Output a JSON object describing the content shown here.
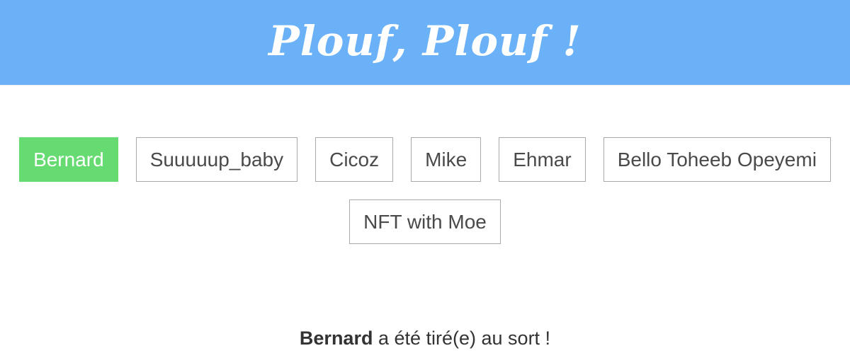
{
  "header": {
    "title": "Plouf, Plouf !",
    "background_color": "#6ab1f7"
  },
  "names": [
    {
      "label": "Bernard",
      "selected": true
    },
    {
      "label": "Suuuuup_baby",
      "selected": false
    },
    {
      "label": "Cicoz",
      "selected": false
    },
    {
      "label": "Mike",
      "selected": false
    },
    {
      "label": "Ehmar",
      "selected": false
    },
    {
      "label": "Bello Toheeb Opeyemi",
      "selected": false
    },
    {
      "label": "NFT with Moe",
      "selected": false
    }
  ],
  "selected_color": "#66db72",
  "result": {
    "winner": "Bernard",
    "message": " a été tiré(e) au sort !"
  }
}
